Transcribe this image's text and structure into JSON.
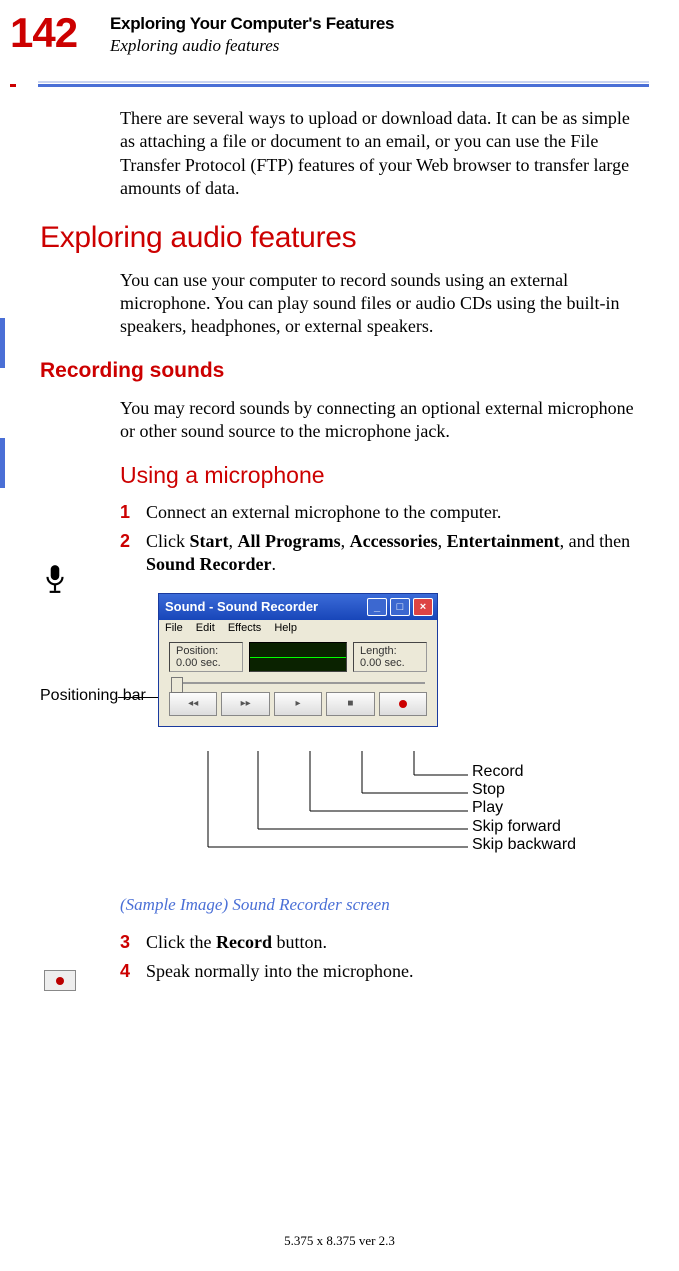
{
  "page_number": "142",
  "chapter_title": "Exploring Your Computer's Features",
  "section_title_header": "Exploring audio features",
  "intro_para": "There are several ways to upload or download data. It can be as simple as attaching a file or document to an email, or you can use the File Transfer Protocol (FTP) features of your Web browser to transfer large amounts of data.",
  "h1": "Exploring audio features",
  "h1_para": "You can use your computer to record sounds using an external microphone. You can play sound files or audio CDs using the built-in speakers, headphones, or external speakers.",
  "h2": "Recording sounds",
  "h2_para": "You may record sounds by connecting an optional external microphone or other sound source to the microphone jack.",
  "h3": "Using a microphone",
  "steps": {
    "s1_num": "1",
    "s1_text": "Connect an external microphone to the computer.",
    "s2_num": "2",
    "s2_prefix": "Click ",
    "s2_b1": "Start",
    "s2_c1": ", ",
    "s2_b2": "All Programs",
    "s2_c2": ", ",
    "s2_b3": "Accessories",
    "s2_c3": ", ",
    "s2_b4": "Entertainment",
    "s2_c4": ", and then ",
    "s2_b5": "Sound Recorder",
    "s2_c5": ".",
    "s3_num": "3",
    "s3_prefix": "Click the ",
    "s3_b1": "Record",
    "s3_suffix": " button.",
    "s4_num": "4",
    "s4_text": "Speak normally into the microphone."
  },
  "positioning_label": "Positioning bar",
  "sound_recorder": {
    "title": "Sound - Sound Recorder",
    "menu_file": "File",
    "menu_edit": "Edit",
    "menu_effects": "Effects",
    "menu_help": "Help",
    "position_label": "Position:",
    "position_value": "0.00 sec.",
    "length_label": "Length:",
    "length_value": "0.00 sec."
  },
  "callouts": {
    "record": "Record",
    "stop": "Stop",
    "play": "Play",
    "skip_forward": "Skip forward",
    "skip_backward": "Skip backward"
  },
  "caption": "(Sample Image) Sound Recorder screen",
  "footer": "5.375 x 8.375 ver 2.3"
}
